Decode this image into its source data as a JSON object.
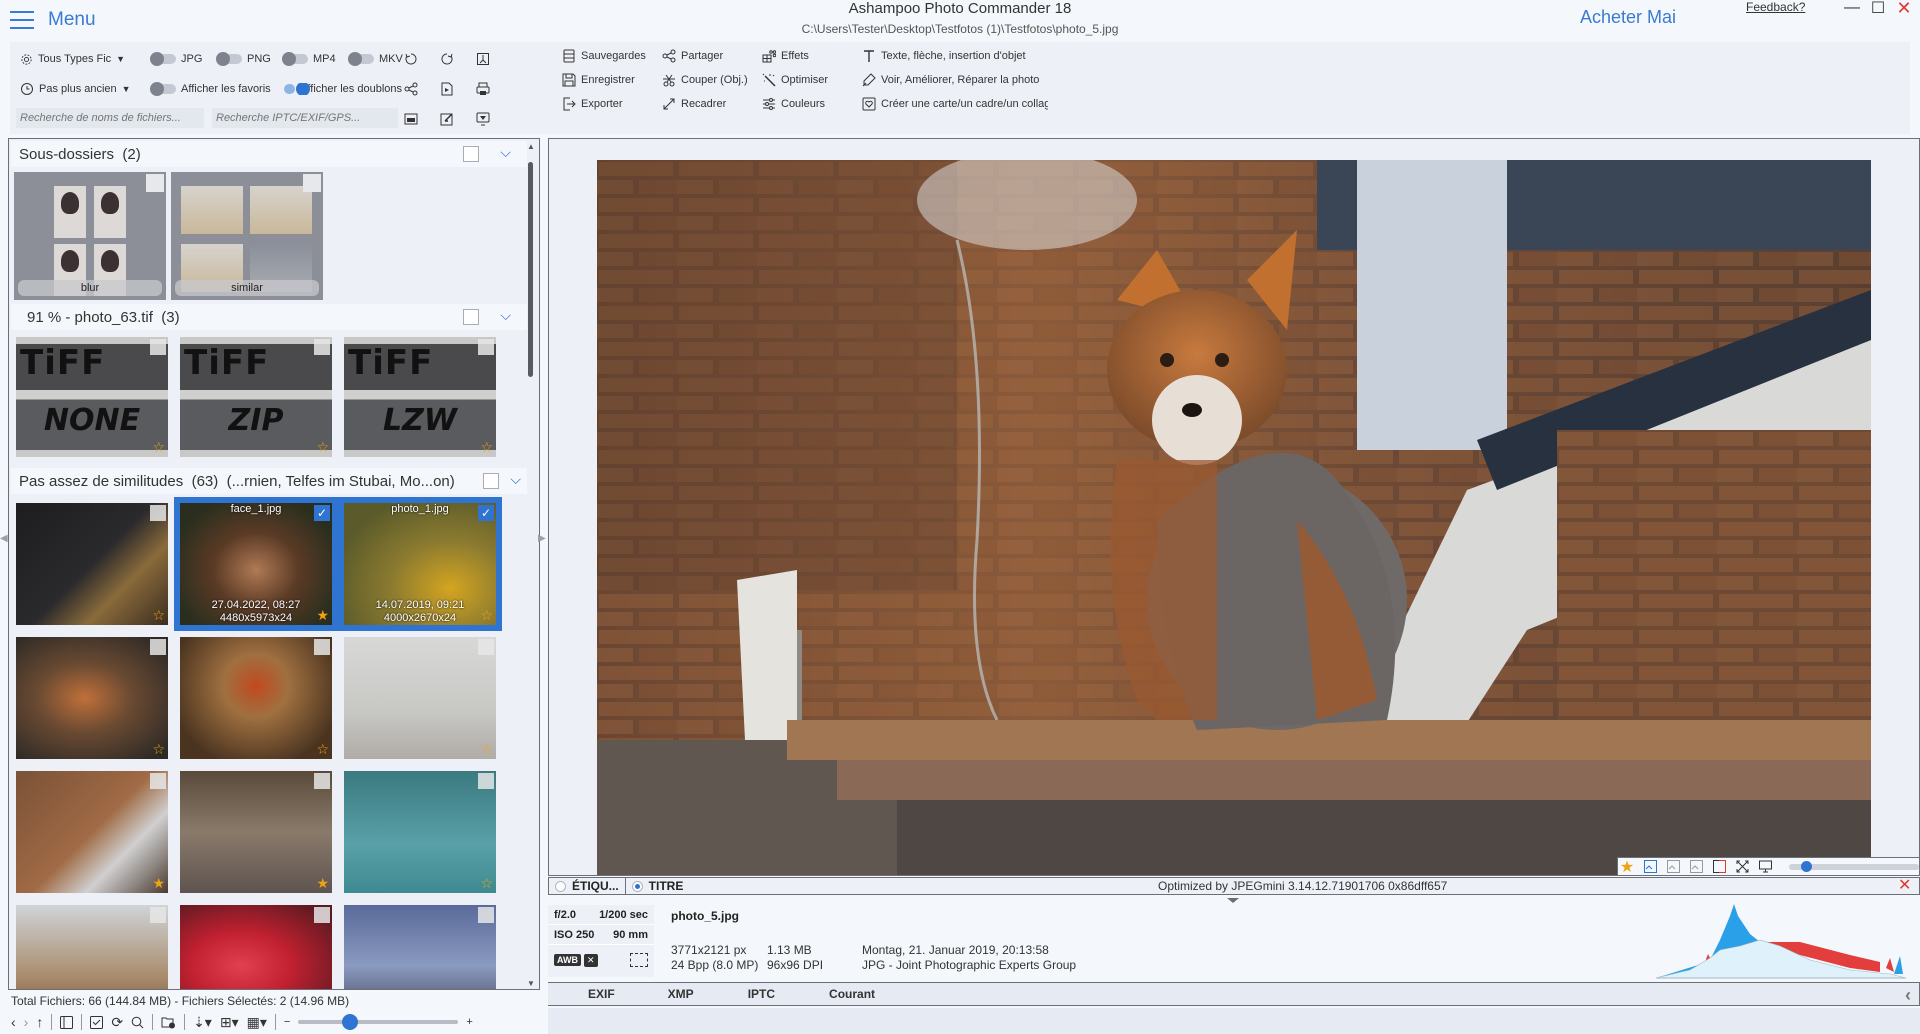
{
  "app": {
    "title": "Ashampoo Photo Commander 18",
    "path": "C:\\Users\\Tester\\Desktop\\Testfotos (1)\\Testfotos\\photo_5.jpg",
    "menu_label": "Menu",
    "buy_label": "Acheter Mai",
    "feedback_label": "Feedback?",
    "window_controls": {
      "minimize": "—",
      "maximize": "☐",
      "close": "✕"
    }
  },
  "filters": {
    "file_types_label": "Tous Types Fic",
    "age_label": "Pas plus ancien",
    "toggles": [
      {
        "label": "JPG",
        "on": false
      },
      {
        "label": "PNG",
        "on": false
      },
      {
        "label": "MP4",
        "on": false
      },
      {
        "label": "MKV",
        "on": false
      }
    ],
    "show_favorites": {
      "label": "Afficher les favoris",
      "on": false
    },
    "show_duplicates": {
      "label": "Afficher les doublons",
      "on": true
    },
    "search_filename_placeholder": "Recherche de noms de fichiers...",
    "search_meta_placeholder": "Recherche IPTC/EXIF/GPS..."
  },
  "actions": {
    "col1": [
      "Sauvegardes",
      "Enregistrer",
      "Exporter"
    ],
    "col2": [
      "Partager",
      "Couper (Obj.)",
      "Recadrer"
    ],
    "col3": [
      "Effets",
      "Optimiser",
      "Couleurs"
    ],
    "col4": [
      "Texte, flèche, insertion d'objet",
      "Voir, Améliorer, Réparer la photo",
      "Créer une carte/un cadre/un collage"
    ]
  },
  "browser": {
    "groups": [
      {
        "title": "Sous-dossiers",
        "count": "(2)"
      },
      {
        "title": "91 % - photo_63.tif",
        "count": "(3)"
      },
      {
        "title": "Pas assez de similitudes",
        "count": "(63)",
        "extra": "(...rnien, Telfes im Stubai, Mo...on)"
      }
    ],
    "folders": [
      {
        "name": "blur"
      },
      {
        "name": "similar"
      }
    ],
    "tiff_group": [
      {
        "caption": "NONE",
        "favorite": false
      },
      {
        "caption": "ZIP",
        "favorite": false
      },
      {
        "caption": "LZW",
        "favorite": false
      }
    ],
    "items": [
      {
        "name": "",
        "subject": "plant",
        "selected": false,
        "favorite": false
      },
      {
        "name": "face_1.jpg",
        "date": "27.04.2022, 08:27",
        "dims": "4480x5973x24",
        "subject": "face",
        "selected": true,
        "favorite": true
      },
      {
        "name": "photo_1.jpg",
        "date": "14.07.2019, 09:21",
        "dims": "4000x2670x24",
        "subject": "bee",
        "selected": true,
        "favorite": false
      },
      {
        "subject": "fox",
        "selected": false,
        "favorite": false
      },
      {
        "subject": "ladybug",
        "selected": false,
        "favorite": false
      },
      {
        "subject": "cat",
        "selected": false,
        "favorite": false
      },
      {
        "subject": "fox-roof",
        "selected": false,
        "favorite": true
      },
      {
        "subject": "duck",
        "selected": false,
        "favorite": true
      },
      {
        "subject": "eagle",
        "selected": false,
        "favorite": false
      },
      {
        "subject": "birds",
        "selected": false,
        "favorite": false
      },
      {
        "subject": "ladybug-flower",
        "selected": false,
        "favorite": false
      },
      {
        "subject": "bird",
        "selected": false,
        "favorite": false
      }
    ],
    "status": "Total Fichiers: 66 (144.84 MB) - Fichiers Sélectés: 2 (14.96 MB)",
    "thumb_size_level": 0.3
  },
  "viewer": {
    "zoom_level": 0.1,
    "tabs": [
      {
        "label": "ÉTIQU...",
        "active": false
      },
      {
        "label": "TITRE",
        "active": true
      }
    ],
    "comment": "Optimized by JPEGmini 3.14.12.71901706 0x86dff657"
  },
  "info": {
    "aperture": "f/2.0",
    "shutter": "1/200 sec",
    "iso": "ISO 250",
    "focal": "90 mm",
    "awb": "AWB",
    "file_name": "photo_5.jpg",
    "resolution": "3771x2121 px",
    "bpp": "24 Bpp (8.0 MP)",
    "size": "1.13 MB",
    "dpi": "96x96 DPI",
    "date": "Montag, 21. Januar 2019, 20:13:58",
    "format": "JPG - Joint Photographic Experts Group",
    "meta_tabs": [
      "EXIF",
      "XMP",
      "IPTC",
      "Courant"
    ]
  },
  "colors": {
    "accent": "#2f74d0",
    "star": "#f1a20f",
    "close": "#e03a2f"
  }
}
